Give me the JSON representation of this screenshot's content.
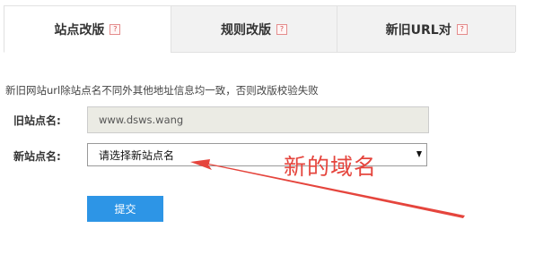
{
  "tabs": [
    {
      "label": "站点改版",
      "help": "?",
      "active": true
    },
    {
      "label": "规则改版",
      "help": "?",
      "active": false
    },
    {
      "label": "新旧URL对",
      "help": "?",
      "active": false
    }
  ],
  "notice": "新旧网站url除站点名不同外其他地址信息均一致，否则改版校验失败",
  "form": {
    "old_site_label": "旧站点名:",
    "old_site_value": "www.dsws.wang",
    "new_site_label": "新站点名:",
    "new_site_selected": "请选择新站点名",
    "submit_label": "提交"
  },
  "annotation": {
    "text": "新的域名",
    "color": "#e5453d"
  },
  "colors": {
    "submit": "#2d95e6",
    "help_icon": "#d45050"
  }
}
